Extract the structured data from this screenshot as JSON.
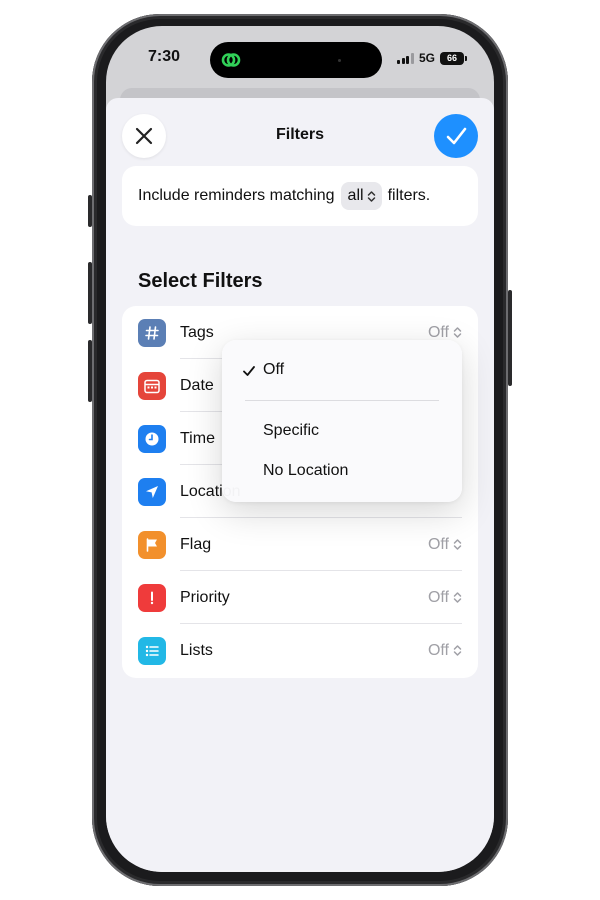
{
  "status_bar": {
    "time": "7:30",
    "network": "5G",
    "battery": "66"
  },
  "sheet": {
    "title": "Filters"
  },
  "match": {
    "prefix": "Include reminders matching",
    "value": "all",
    "suffix": "filters."
  },
  "section_title": "Select Filters",
  "filters": [
    {
      "label": "Tags",
      "value": "Off",
      "icon": "hashtag-icon",
      "color": "#5b7fb5"
    },
    {
      "label": "Date",
      "value": "",
      "icon": "calendar-icon",
      "color": "#e5453a"
    },
    {
      "label": "Time",
      "value": "",
      "icon": "clock-icon",
      "color": "#1e7ff0"
    },
    {
      "label": "Location",
      "value": "",
      "icon": "location-arrow-icon",
      "color": "#1e7ff0"
    },
    {
      "label": "Flag",
      "value": "Off",
      "icon": "flag-icon",
      "color": "#f2902c"
    },
    {
      "label": "Priority",
      "value": "Off",
      "icon": "exclamation-icon",
      "color": "#ef3b3b"
    },
    {
      "label": "Lists",
      "value": "Off",
      "icon": "list-icon",
      "color": "#22b8e6"
    }
  ],
  "location_menu": {
    "selected": "Off",
    "options": [
      "Specific",
      "No Location"
    ]
  },
  "colors": {
    "accent": "#1e90ff",
    "sheet_bg": "#f2f2f7"
  }
}
